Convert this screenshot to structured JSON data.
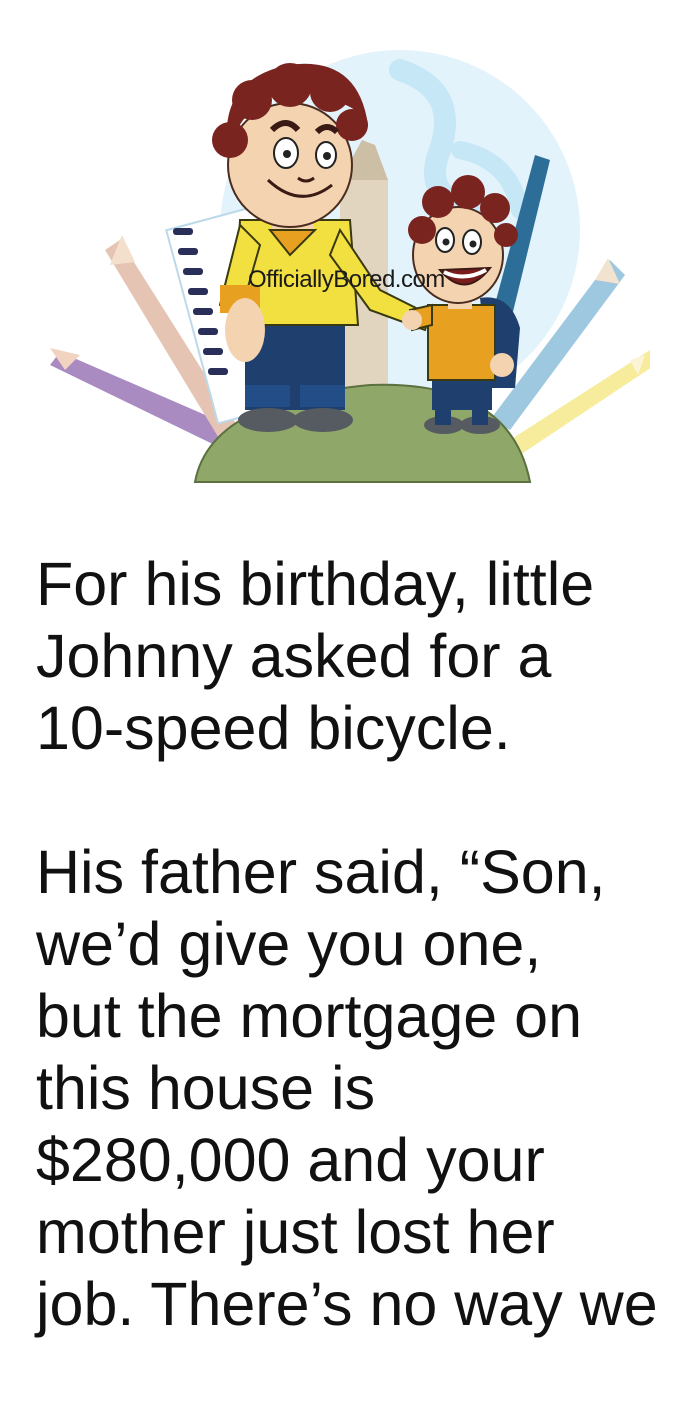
{
  "illustration": {
    "description_icon": "father-and-son-cartoon",
    "watermark": "OfficiallyBored.com"
  },
  "story": {
    "paragraphs": [
      {
        "lines": [
          "For his birthday, little",
          "Johnny asked for a",
          "10-speed bicycle."
        ]
      },
      {
        "lines": [
          "His father said, “Son,",
          "we’d give you one,",
          "but the mortgage on",
          "this house is",
          "$280,000 and your",
          "mother just lost her",
          "job. There’s no way we"
        ]
      }
    ]
  },
  "colors": {
    "hair": "#7a2420",
    "shirt_yellow": "#f2e040",
    "shirt_orange": "#e8a020",
    "pants": "#1f3f6e",
    "hill": "#8fa86a"
  }
}
